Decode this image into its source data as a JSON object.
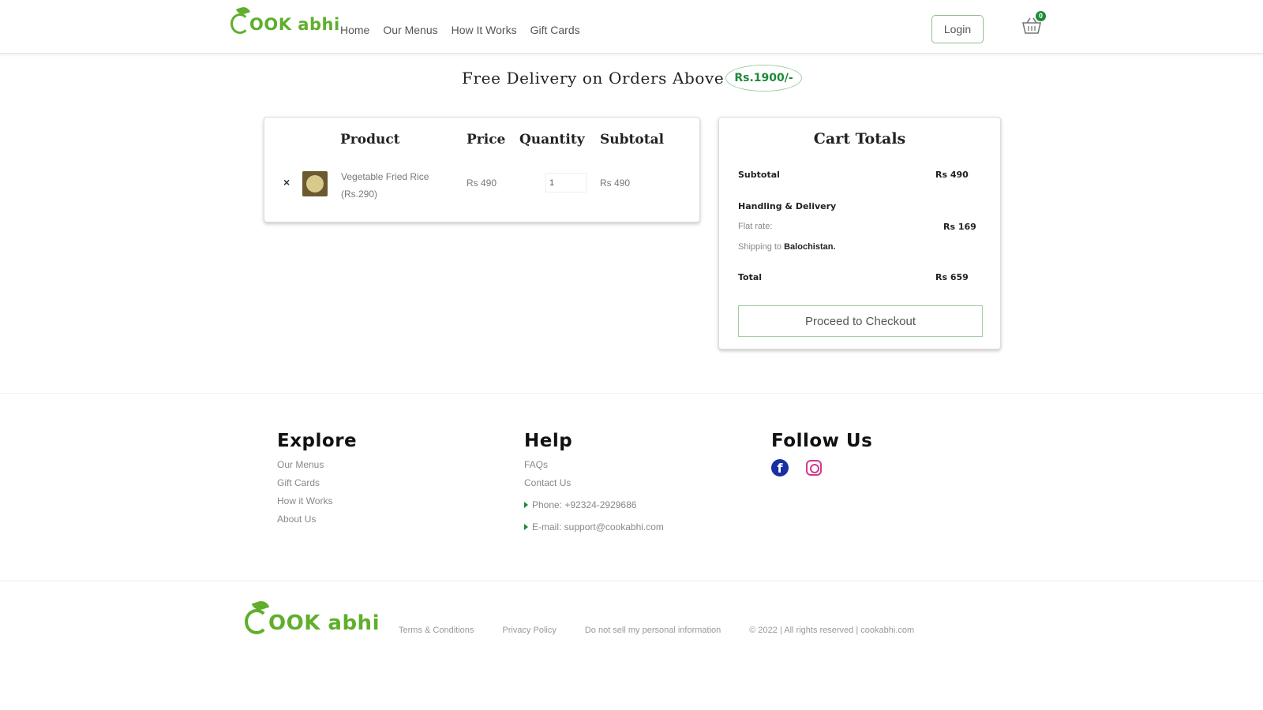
{
  "header": {
    "logo_text": "OOK abhi",
    "nav": [
      "Home",
      "Our Menus",
      "How It Works",
      "Gift Cards"
    ],
    "login_label": "Login",
    "cart_count": "0"
  },
  "promo": {
    "text": "Free Delivery on Orders Above",
    "amount": "Rs.1900/-"
  },
  "cart": {
    "headers": {
      "product": "Product",
      "price": "Price",
      "quantity": "Quantity",
      "subtotal": "Subtotal"
    },
    "items": [
      {
        "remove": "×",
        "name": "Vegetable Fried Rice",
        "unit": "(Rs.290)",
        "price": "Rs 490",
        "quantity": "1",
        "subtotal": "Rs 490"
      }
    ]
  },
  "totals": {
    "title": "Cart Totals",
    "subtotal_label": "Subtotal",
    "subtotal_value": "Rs 490",
    "shipping_label": "Handling & Delivery",
    "flat_rate_label": "Flat rate:",
    "flat_rate_value": "Rs 169",
    "shipping_to_prefix": "Shipping to",
    "shipping_to_region": "Balochistan.",
    "total_label": "Total",
    "total_value": "Rs 659",
    "checkout_label": "Proceed to Checkout"
  },
  "footer": {
    "explore": {
      "title": "Explore",
      "links": [
        "Our Menus",
        "Gift Cards",
        "How it Works",
        "About Us"
      ]
    },
    "help": {
      "title": "Help",
      "links": [
        "FAQs",
        "Contact Us"
      ],
      "phone": "Phone: +92324-2929686",
      "email": "E-mail: support@cookabhi.com"
    },
    "follow": {
      "title": "Follow Us",
      "icons": [
        "facebook-icon",
        "instagram-icon"
      ]
    },
    "bottom": {
      "logo_text": "OOK abhi",
      "links": [
        "Terms & Conditions",
        "Privacy Policy",
        "Do not sell my personal information"
      ],
      "copyright": "© 2022 | All rights reserved | cookabhi.com"
    }
  },
  "colors": {
    "brand": "#5fae2c",
    "accent_dark": "#1c8a3a",
    "facebook": "#1a2fa0",
    "instagram": "#d3398d"
  }
}
